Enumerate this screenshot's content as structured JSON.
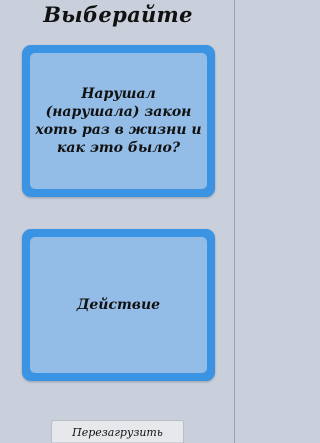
{
  "header": {
    "title": "Выберайте"
  },
  "cards": {
    "truth": {
      "text": "Нарушал (нарушала) закон хоть раз в жизни и как это было?"
    },
    "dare": {
      "text": "Действие"
    }
  },
  "footer": {
    "reload_label": "Перезагрузить"
  },
  "colors": {
    "background": "#c9d0dc",
    "card_border": "#3a93e3",
    "card_fill": "#93bde6",
    "button_fill": "#e6e8ec"
  }
}
